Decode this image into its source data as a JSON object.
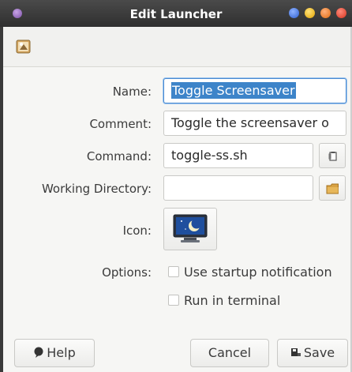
{
  "window": {
    "title": "Edit Launcher"
  },
  "form": {
    "name_label": "Name:",
    "name_value": "Toggle Screensaver",
    "comment_label": "Comment:",
    "comment_value": "Toggle the screensaver o",
    "command_label": "Command:",
    "command_value": "toggle-ss.sh",
    "workdir_label": "Working Directory:",
    "workdir_value": "",
    "icon_label": "Icon:",
    "options_label": "Options:",
    "opt_startup": "Use startup notification",
    "opt_terminal": "Run in terminal"
  },
  "buttons": {
    "help": "Help",
    "cancel": "Cancel",
    "save": "Save"
  },
  "icons": {
    "menu": "window-menu-icon",
    "toolbar": "launcher-edit-icon",
    "command_browse": "file-chooser-icon",
    "workdir_browse": "folder-icon",
    "launcher_icon": "screensaver-moon-icon",
    "help": "help-icon",
    "save": "save-icon"
  },
  "colors": {
    "titlebar": "#3a3a3a",
    "selection": "#3d84c9",
    "folder": "#d8a243"
  }
}
